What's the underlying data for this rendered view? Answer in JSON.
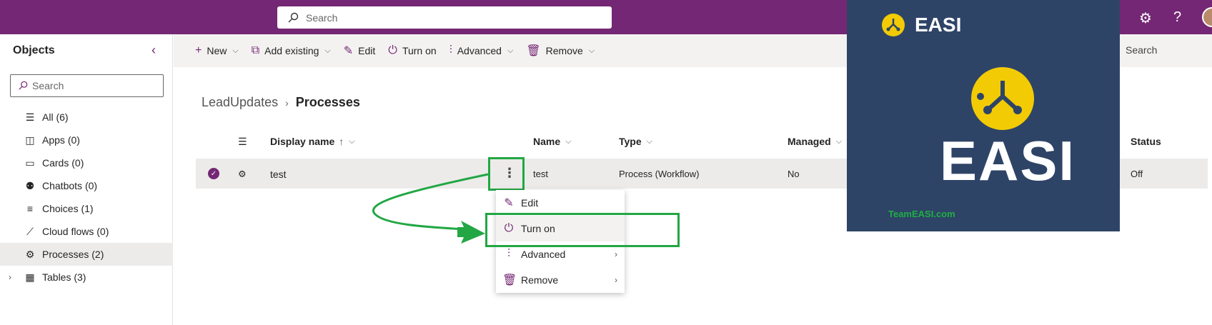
{
  "topbar": {
    "search_placeholder": "Search"
  },
  "sidebar": {
    "title": "Objects",
    "search_placeholder": "Search",
    "items": [
      {
        "label": "All",
        "count": "(6)",
        "icon": "list-icon"
      },
      {
        "label": "Apps",
        "count": "(0)",
        "icon": "apps-icon"
      },
      {
        "label": "Cards",
        "count": "(0)",
        "icon": "cards-icon"
      },
      {
        "label": "Chatbots",
        "count": "(0)",
        "icon": "chatbot-icon"
      },
      {
        "label": "Choices",
        "count": "(1)",
        "icon": "choices-icon"
      },
      {
        "label": "Cloud flows",
        "count": "(0)",
        "icon": "flow-icon"
      },
      {
        "label": "Processes",
        "count": "(2)",
        "icon": "process-icon",
        "active": true
      },
      {
        "label": "Tables",
        "count": "(3)",
        "icon": "table-icon"
      }
    ]
  },
  "commandbar": {
    "new": "New",
    "add_existing": "Add existing",
    "edit": "Edit",
    "turn_on": "Turn on",
    "advanced": "Advanced",
    "remove": "Remove",
    "search": "Search"
  },
  "breadcrumb": {
    "parent": "LeadUpdates",
    "current": "Processes"
  },
  "table": {
    "columns": {
      "display_name": "Display name",
      "sort_indicator": "↑",
      "name": "Name",
      "type": "Type",
      "managed": "Managed",
      "status": "Status"
    },
    "rows": [
      {
        "display_name": "test",
        "name": "test",
        "type": "Process (Workflow)",
        "managed": "No",
        "status": "Off"
      }
    ]
  },
  "context_menu": {
    "items": [
      {
        "label": "Edit",
        "icon": "edit-icon"
      },
      {
        "label": "Turn on",
        "icon": "power-icon"
      },
      {
        "label": "Advanced",
        "icon": "advanced-icon"
      },
      {
        "label": "Remove",
        "icon": "trash-icon"
      }
    ]
  },
  "overlay": {
    "brand_small": "EASI",
    "brand_large": "EASI",
    "url": "TeamEASI.com"
  },
  "colors": {
    "brand": "#742774",
    "annotation": "#22a744",
    "easi_bg": "#2e4467",
    "easi_yellow": "#f2cb05"
  }
}
